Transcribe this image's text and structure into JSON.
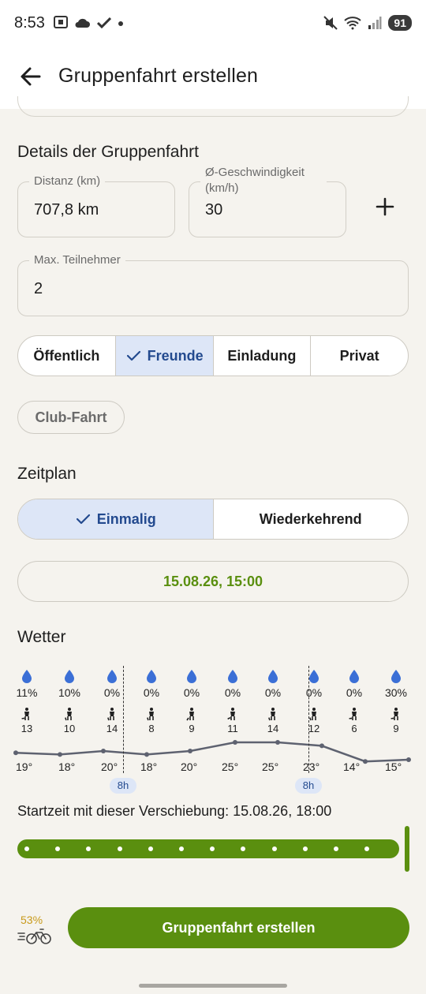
{
  "status_bar": {
    "time": "8:53",
    "left_icons": [
      "screenshot-icon",
      "cloud-icon",
      "check-icon",
      "dot"
    ],
    "right_icons": [
      "mute-icon",
      "wifi-icon",
      "signal-icon"
    ],
    "battery": "91"
  },
  "app_bar": {
    "title": "Gruppenfahrt erstellen"
  },
  "details": {
    "section_title": "Details der Gruppenfahrt",
    "distance": {
      "label": "Distanz (km)",
      "value": "707,8 km"
    },
    "speed": {
      "label": "Ø-Geschwindigkeit (km/h)",
      "value": "30"
    },
    "max_participants": {
      "label": "Max. Teilnehmer",
      "value": "2"
    },
    "visibility": {
      "options": [
        "Öffentlich",
        "Freunde",
        "Einladung",
        "Privat"
      ],
      "selected": "Freunde"
    },
    "club_chip": "Club-Fahrt"
  },
  "schedule": {
    "section_title": "Zeitplan",
    "options": [
      "Einmalig",
      "Wiederkehrend"
    ],
    "selected": "Einmalig",
    "datetime": "15.08.26, 15:00"
  },
  "weather": {
    "section_title": "Wetter",
    "precipitation": [
      "11%",
      "10%",
      "0%",
      "0%",
      "0%",
      "0%",
      "0%",
      "0%",
      "0%",
      "30%"
    ],
    "wind": [
      "13",
      "10",
      "14",
      "8",
      "9",
      "11",
      "14",
      "12",
      "6",
      "9"
    ],
    "temperatures": [
      "19°",
      "18°",
      "20°",
      "18°",
      "20°",
      "25°",
      "25°",
      "23°",
      "14°",
      "15°"
    ],
    "temperature_values": [
      19,
      18,
      20,
      18,
      20,
      25,
      25,
      23,
      14,
      15
    ],
    "shift_badges": [
      "8h",
      "8h"
    ],
    "colors": {
      "drop": "#3b6fd6",
      "line": "#5e6270"
    }
  },
  "shift": {
    "text": "Startzeit mit dieser Verschiebung: 15.08.26, 18:00",
    "value": 1.0
  },
  "footer": {
    "battery_level": "53%",
    "create_button": "Gruppenfahrt erstellen"
  },
  "colors": {
    "accent_green": "#5a8f0f",
    "selected_blue_bg": "#dde6f7",
    "selected_blue_text": "#234a8f",
    "background": "#f5f3ee"
  }
}
